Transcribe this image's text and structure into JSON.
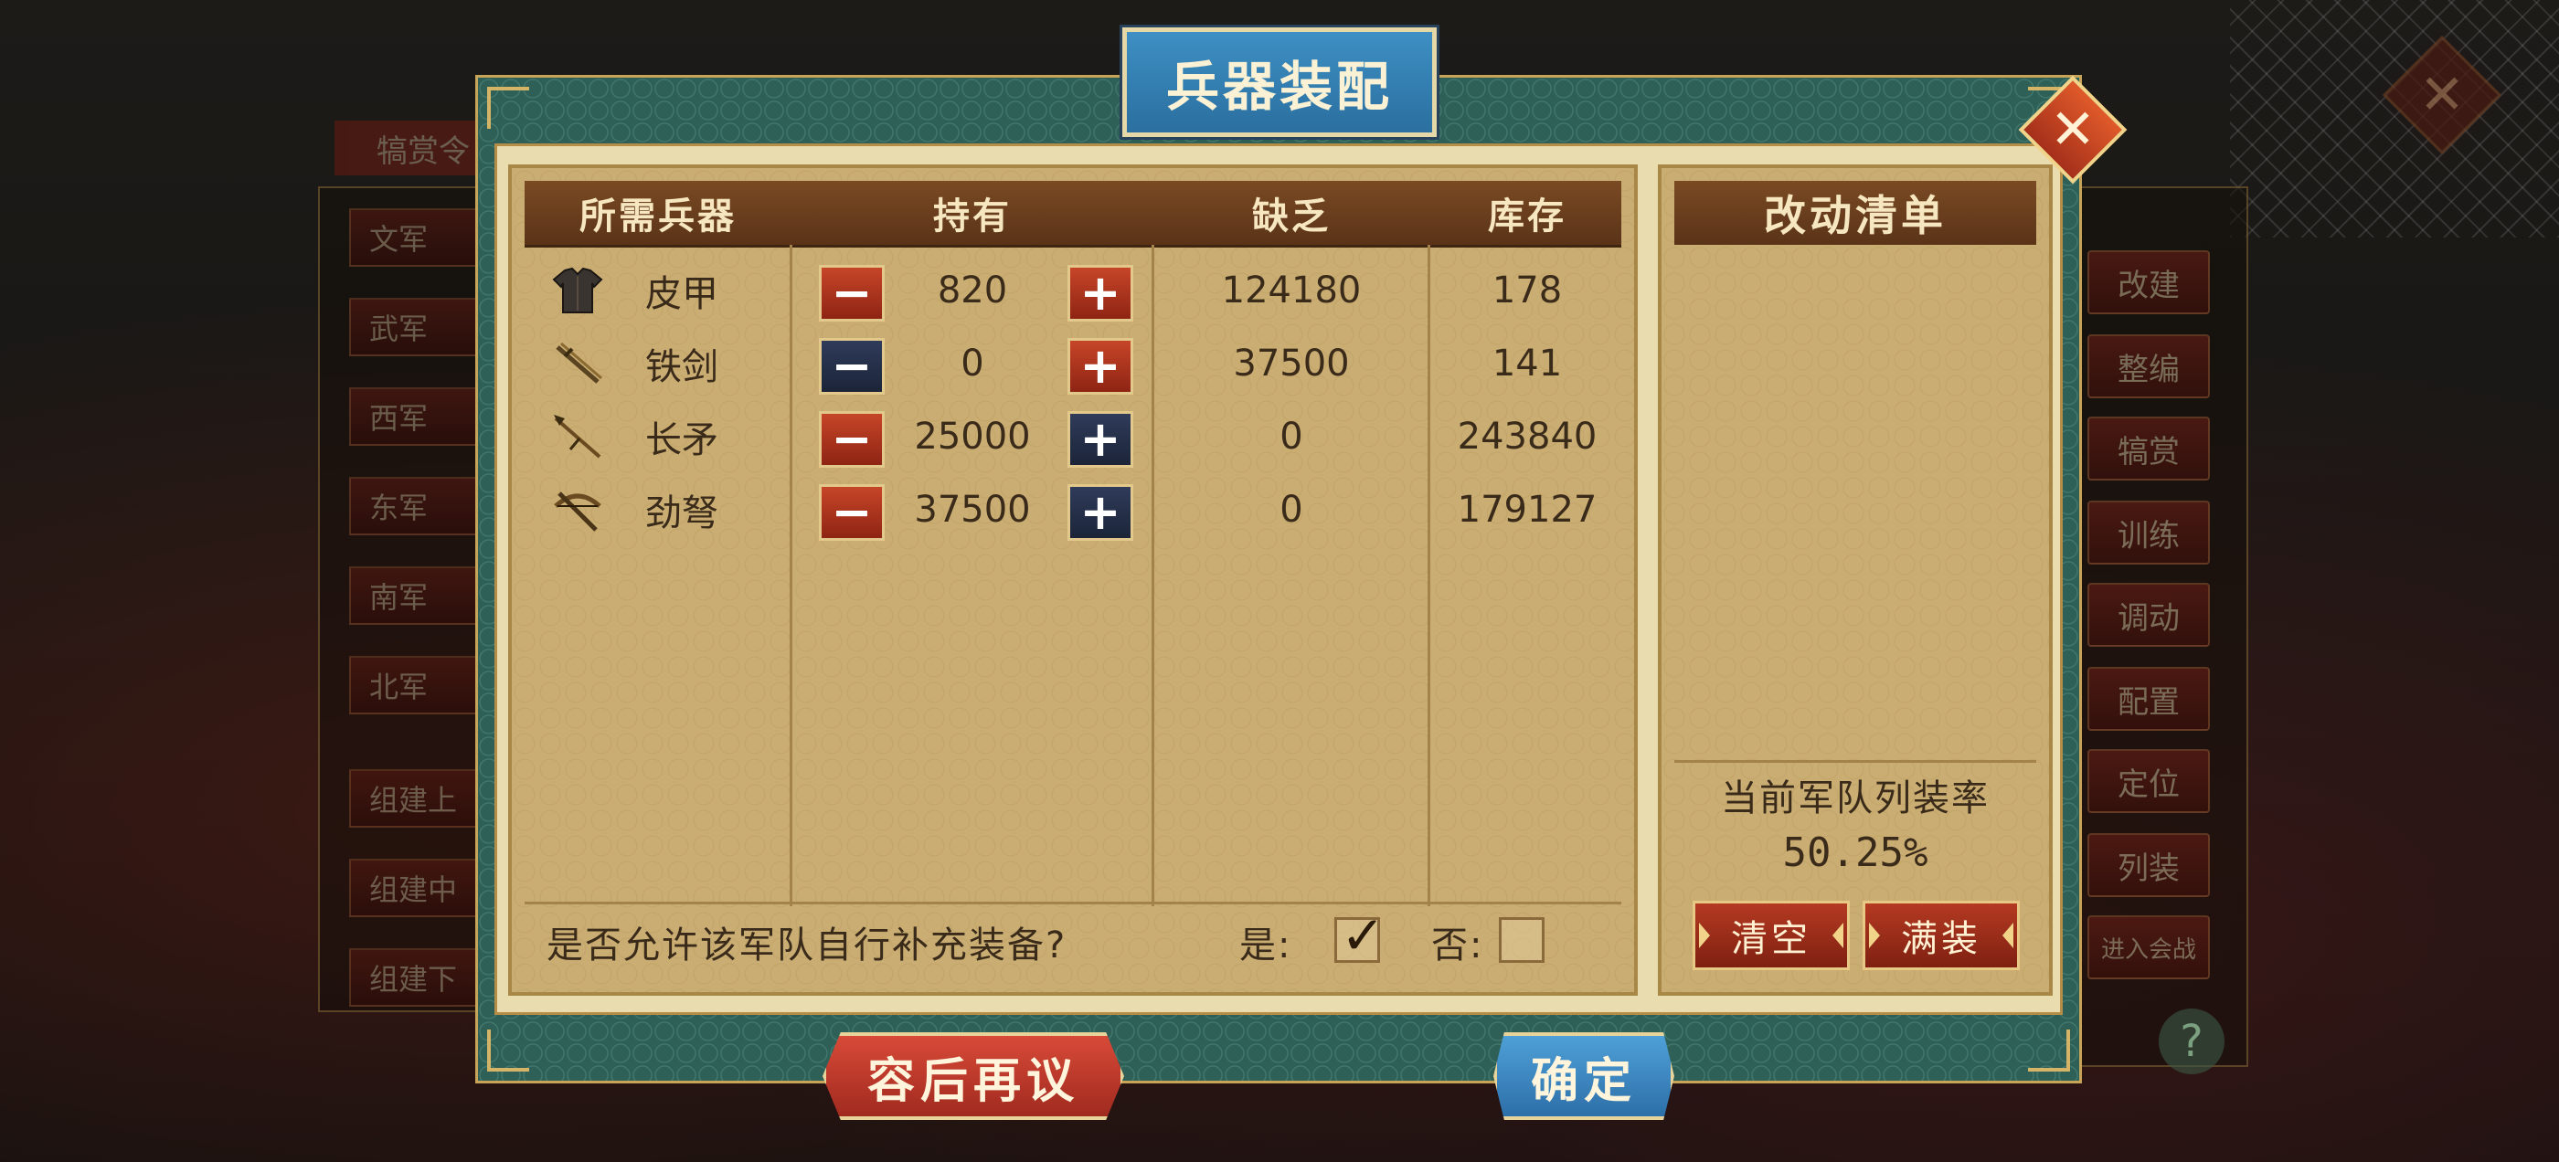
{
  "background": {
    "left_tab": "犒赏令",
    "left_buttons": [
      "文军",
      "武军",
      "西军",
      "东军",
      "南军",
      "北军",
      "组建上",
      "组建中",
      "组建下"
    ],
    "right_buttons": [
      "改建",
      "整编",
      "犒赏",
      "训练",
      "调动",
      "配置",
      "定位",
      "列装",
      "进入会战"
    ],
    "help_icon": "?"
  },
  "dialog": {
    "title": "兵器装配",
    "close_icon": "close-icon"
  },
  "weapons_table": {
    "headers": [
      "所需兵器",
      "持有",
      "缺乏",
      "库存"
    ],
    "rows": [
      {
        "name": "皮甲",
        "icon": "leather-armor-icon",
        "held": "820",
        "lacking": "124180",
        "stock": "178",
        "minus_style": "red",
        "plus_style": "red"
      },
      {
        "name": "铁剑",
        "icon": "iron-sword-icon",
        "held": "0",
        "lacking": "37500",
        "stock": "141",
        "minus_style": "navy",
        "plus_style": "red"
      },
      {
        "name": "长矛",
        "icon": "long-spear-icon",
        "held": "25000",
        "lacking": "0",
        "stock": "243840",
        "minus_style": "red",
        "plus_style": "navy"
      },
      {
        "name": "劲弩",
        "icon": "crossbow-icon",
        "held": "37500",
        "lacking": "0",
        "stock": "179127",
        "minus_style": "red",
        "plus_style": "navy"
      }
    ],
    "minus_symbol": "−",
    "plus_symbol": "+",
    "question": "是否允许该军队自行补充装备?",
    "yes_label": "是:",
    "no_label": "否:",
    "yes_checked": true,
    "no_checked": false
  },
  "change_list": {
    "title": "改动清单",
    "rate_label": "当前军队列装率",
    "rate_value": "50.25%",
    "clear_button": "清空",
    "full_button": "满装"
  },
  "buttons": {
    "later": "容后再议",
    "confirm": "确定"
  },
  "colors": {
    "teal_frame": "#2f6058",
    "parchment": "#c9ad72",
    "header_brown": "#6a3d1d",
    "red_button": "#b43a22",
    "navy_button": "#1f2940",
    "blue_button": "#3a84bd"
  }
}
